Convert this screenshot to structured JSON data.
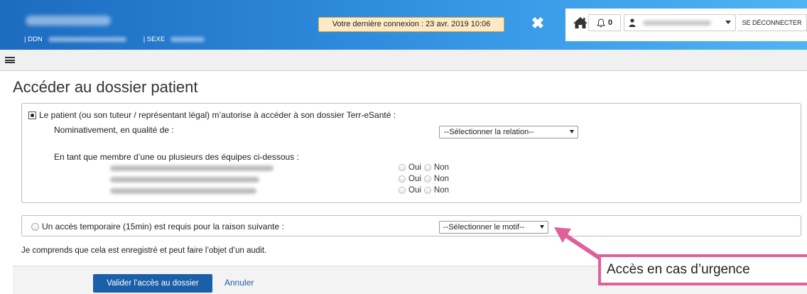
{
  "header": {
    "ddn_label": "| DDN",
    "sexe_label": "| SEXE",
    "last_login": "Votre dernière connexion : 23 avr. 2019 10:06",
    "close_symbol": "✖",
    "notifications_count": "0",
    "logout_label": "SE DÉCONNECTER"
  },
  "page": {
    "title": "Accéder au dossier patient"
  },
  "consent": {
    "option1_label": "Le patient (ou son tuteur / représentant légal) m’autorise à accéder à son dossier Terr-eSanté :",
    "nominative_label": "Nominativement, en qualité de :",
    "relation_select": "--Sélectionner la relation--",
    "teams_label": "En tant que membre d’une ou plusieurs des équipes ci-dessous :",
    "yes_label": "Oui",
    "no_label": "Non",
    "option2_label": "Un accès temporaire (15min) est requis pour la raison suivante :",
    "motif_select": "--Sélectionner le motif--",
    "notice": "Je comprends que cela est enregistré et peut faire l’objet d’un audit."
  },
  "actions": {
    "validate_label": "Valider l’accès au dossier",
    "cancel_label": "Annuler"
  },
  "annotation": {
    "callout_text": "Accès en cas d’urgence",
    "color": "#e0609c"
  }
}
